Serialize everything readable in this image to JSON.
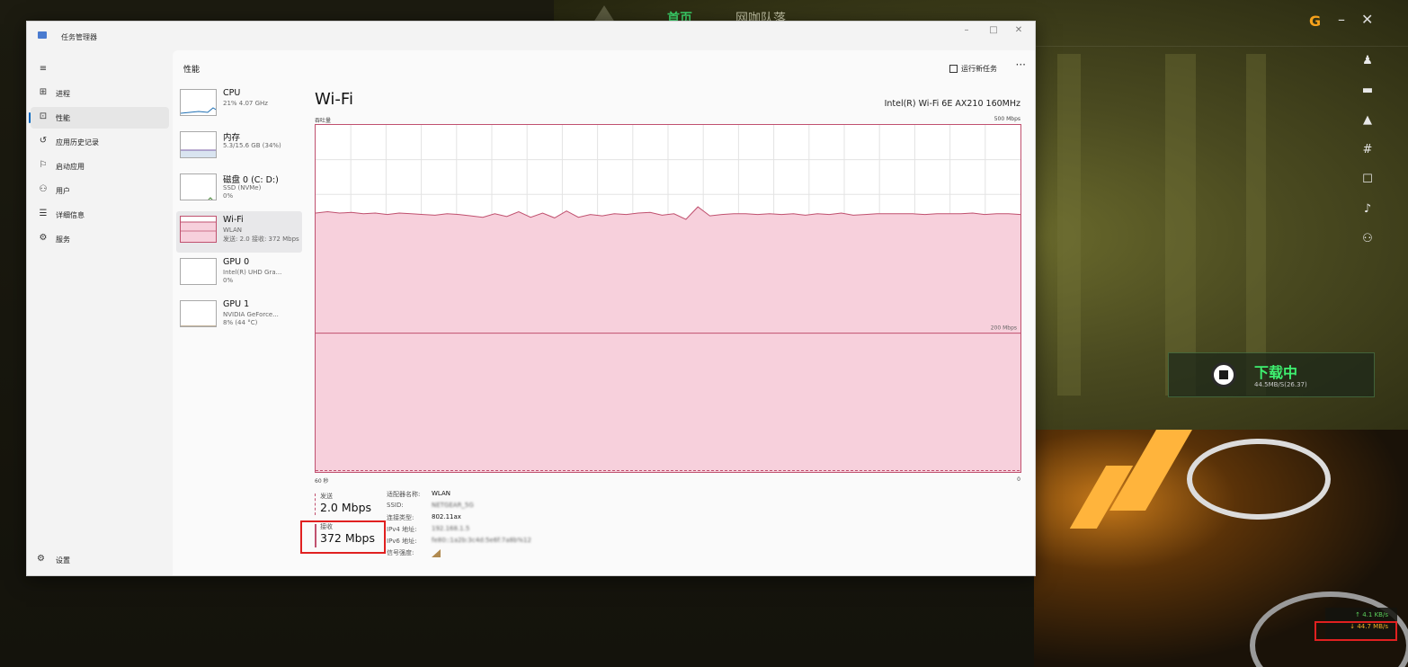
{
  "background_launcher": {
    "nav_home": "首页",
    "nav_team": "网咖队落",
    "download_title": "下载中",
    "download_sub": "44.5MB/S(26.37)",
    "speed_up": "↑ 4.1 KB/s",
    "speed_down": "↓ 44.7 MB/s"
  },
  "window": {
    "title": "任务管理器",
    "controls": [
      "–",
      "□",
      "✕"
    ]
  },
  "nav": {
    "items": [
      {
        "label": "进程",
        "icon": "processes-icon",
        "glyph": "⊞"
      },
      {
        "label": "性能",
        "icon": "performance-icon",
        "glyph": "⊡"
      },
      {
        "label": "应用历史记录",
        "icon": "history-icon",
        "glyph": "↺"
      },
      {
        "label": "启动应用",
        "icon": "startup-icon",
        "glyph": "⚐"
      },
      {
        "label": "用户",
        "icon": "users-icon",
        "glyph": "⚇"
      },
      {
        "label": "详细信息",
        "icon": "details-icon",
        "glyph": "☰"
      },
      {
        "label": "服务",
        "icon": "services-icon",
        "glyph": "⚙"
      }
    ],
    "settings_label": "设置",
    "active_index": 1
  },
  "main": {
    "header_title": "性能",
    "run_task_label": "运行新任务",
    "more_label": "···"
  },
  "devices": [
    {
      "name": "CPU",
      "sub1": "21% 4.07 GHz",
      "sub2": ""
    },
    {
      "name": "内存",
      "sub1": "5.3/15.6 GB (34%)",
      "sub2": ""
    },
    {
      "name": "磁盘 0 (C: D:)",
      "sub1": "SSD (NVMe)",
      "sub2": "0%"
    },
    {
      "name": "Wi-Fi",
      "sub1": "WLAN",
      "sub2": "发送: 2.0 接收: 372 Mbps"
    },
    {
      "name": "GPU 0",
      "sub1": "Intel(R) UHD Gra...",
      "sub2": "0%"
    },
    {
      "name": "GPU 1",
      "sub1": "NVIDIA GeForce...",
      "sub2": "8% (44 °C)"
    }
  ],
  "detail": {
    "title": "Wi-Fi",
    "adapter": "Intel(R) Wi-Fi 6E AX210 160MHz",
    "throughput_label": "吞吐量",
    "max_label": "500 Mbps",
    "mid_label": "200 Mbps",
    "time_left": "60 秒",
    "time_right": "0",
    "send_label": "发送",
    "send_value": "2.0 Mbps",
    "recv_label": "接收",
    "recv_value": "372 Mbps",
    "properties": [
      {
        "key": "适配器名称:",
        "value": "WLAN",
        "blur": false
      },
      {
        "key": "SSID:",
        "value": "NETGEAR_5G",
        "blur": true
      },
      {
        "key": "连接类型:",
        "value": "802.11ax",
        "blur": false
      },
      {
        "key": "IPv4 地址:",
        "value": "192.168.1.5",
        "blur": true
      },
      {
        "key": "IPv6 地址:",
        "value": "fe80::1a2b:3c4d:5e6f:7a8b%12",
        "blur": true
      },
      {
        "key": "信号强度:",
        "value": "",
        "blur": false
      }
    ]
  },
  "chart_data": {
    "type": "area",
    "title": "Wi-Fi",
    "ylabel": "吞吐量",
    "ylim": [
      0,
      500
    ],
    "x_range": [
      "60 秒",
      "0"
    ],
    "grid": true,
    "series": [
      {
        "name": "接收",
        "color": "#c0516f",
        "values": [
          373,
          375,
          373,
          374,
          372,
          373,
          371,
          373,
          372,
          371,
          370,
          372,
          371,
          369,
          367,
          372,
          368,
          375,
          367,
          373,
          366,
          376,
          367,
          371,
          369,
          372,
          371,
          373,
          374,
          370,
          372,
          364,
          382,
          369,
          371,
          372,
          372,
          371,
          372,
          371,
          372,
          370,
          372,
          371,
          373,
          370,
          371,
          372,
          372,
          372,
          372,
          371,
          372,
          372,
          372,
          373,
          371,
          372,
          372,
          371
        ]
      },
      {
        "name": "发送",
        "color": "#c0516f",
        "values": [
          2,
          2,
          2,
          2,
          2,
          2,
          2,
          2,
          2,
          2,
          2,
          2,
          2,
          2,
          2,
          2,
          2,
          2,
          2,
          2,
          2,
          2,
          2,
          2,
          2,
          2,
          2,
          2,
          2,
          2,
          2,
          2,
          2,
          2,
          2,
          2,
          2,
          2,
          2,
          2,
          2,
          2,
          2,
          2,
          2,
          2,
          2,
          2,
          2,
          2,
          2,
          2,
          2,
          2,
          2,
          2,
          2,
          2,
          2,
          2
        ]
      }
    ]
  }
}
